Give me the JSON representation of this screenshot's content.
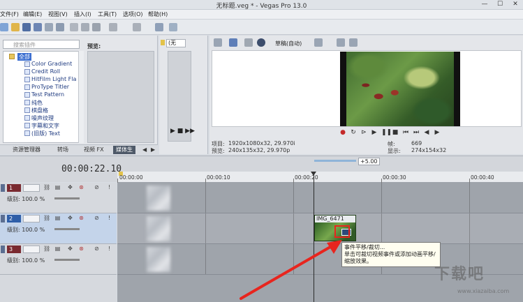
{
  "window": {
    "title": "无标题.veg * - Vegas Pro 13.0",
    "controls": [
      "—",
      "☐",
      "✕"
    ]
  },
  "menu": {
    "items": [
      "文件(F)",
      "编辑(E)",
      "视图(V)",
      "插入(I)",
      "工具(T)",
      "选项(O)",
      "帮助(H)"
    ]
  },
  "explorer": {
    "search_placeholder": "搜索插件",
    "tree": [
      {
        "label": "全部",
        "expanded": true
      },
      {
        "label": "Color Gradient"
      },
      {
        "label": "Credit Roll"
      },
      {
        "label": "HitFilm Light Fla"
      },
      {
        "label": "ProType Titler"
      },
      {
        "label": "Test Pattern"
      },
      {
        "label": "纯色"
      },
      {
        "label": "棋盘格"
      },
      {
        "label": "噪声纹理"
      },
      {
        "label": "字幕和文字"
      },
      {
        "label": "(旧版) Text"
      }
    ],
    "preview_label": "预览:",
    "tabs": [
      "资源管理器",
      "转场",
      "视频 FX",
      "媒体生",
      "◀",
      "▶"
    ]
  },
  "trimmer": {
    "select_value": "(无"
  },
  "preview": {
    "quality": "草稿(自动)",
    "info_lines": {
      "project_label": "项目:",
      "project": "1920x1080x32, 29.970i",
      "preview_label": "预览:",
      "preview": "240x135x32, 29.970p",
      "frame_label": "帧:",
      "frame": "669",
      "display_label": "显示:",
      "display": "274x154x32"
    }
  },
  "timeline": {
    "timecode": "00:00:22.10",
    "rate": "+5.00",
    "ruler": [
      "00:00:00",
      "00:00:10",
      "00:00:20",
      "00:00:30",
      "00:00:40"
    ],
    "tracks": [
      {
        "num": "1",
        "level": "级别: 100.0 %"
      },
      {
        "num": "2",
        "level": "级别: 100.0 %"
      },
      {
        "num": "3",
        "level": "级别: 100.0 %"
      }
    ],
    "clip_title": "IMG_6471"
  },
  "tooltip": {
    "title": "事件平移/裁切...",
    "line1": "单击可裁切视频事件或添加动画平移/",
    "line2": "缩放效果。"
  },
  "watermark": {
    "text": "下载吧",
    "url": "www.xiazaiba.com"
  },
  "colors": {
    "track1": "#7a2a30",
    "track_selected": "#2e5ea8",
    "annotation": "#e8251e"
  }
}
